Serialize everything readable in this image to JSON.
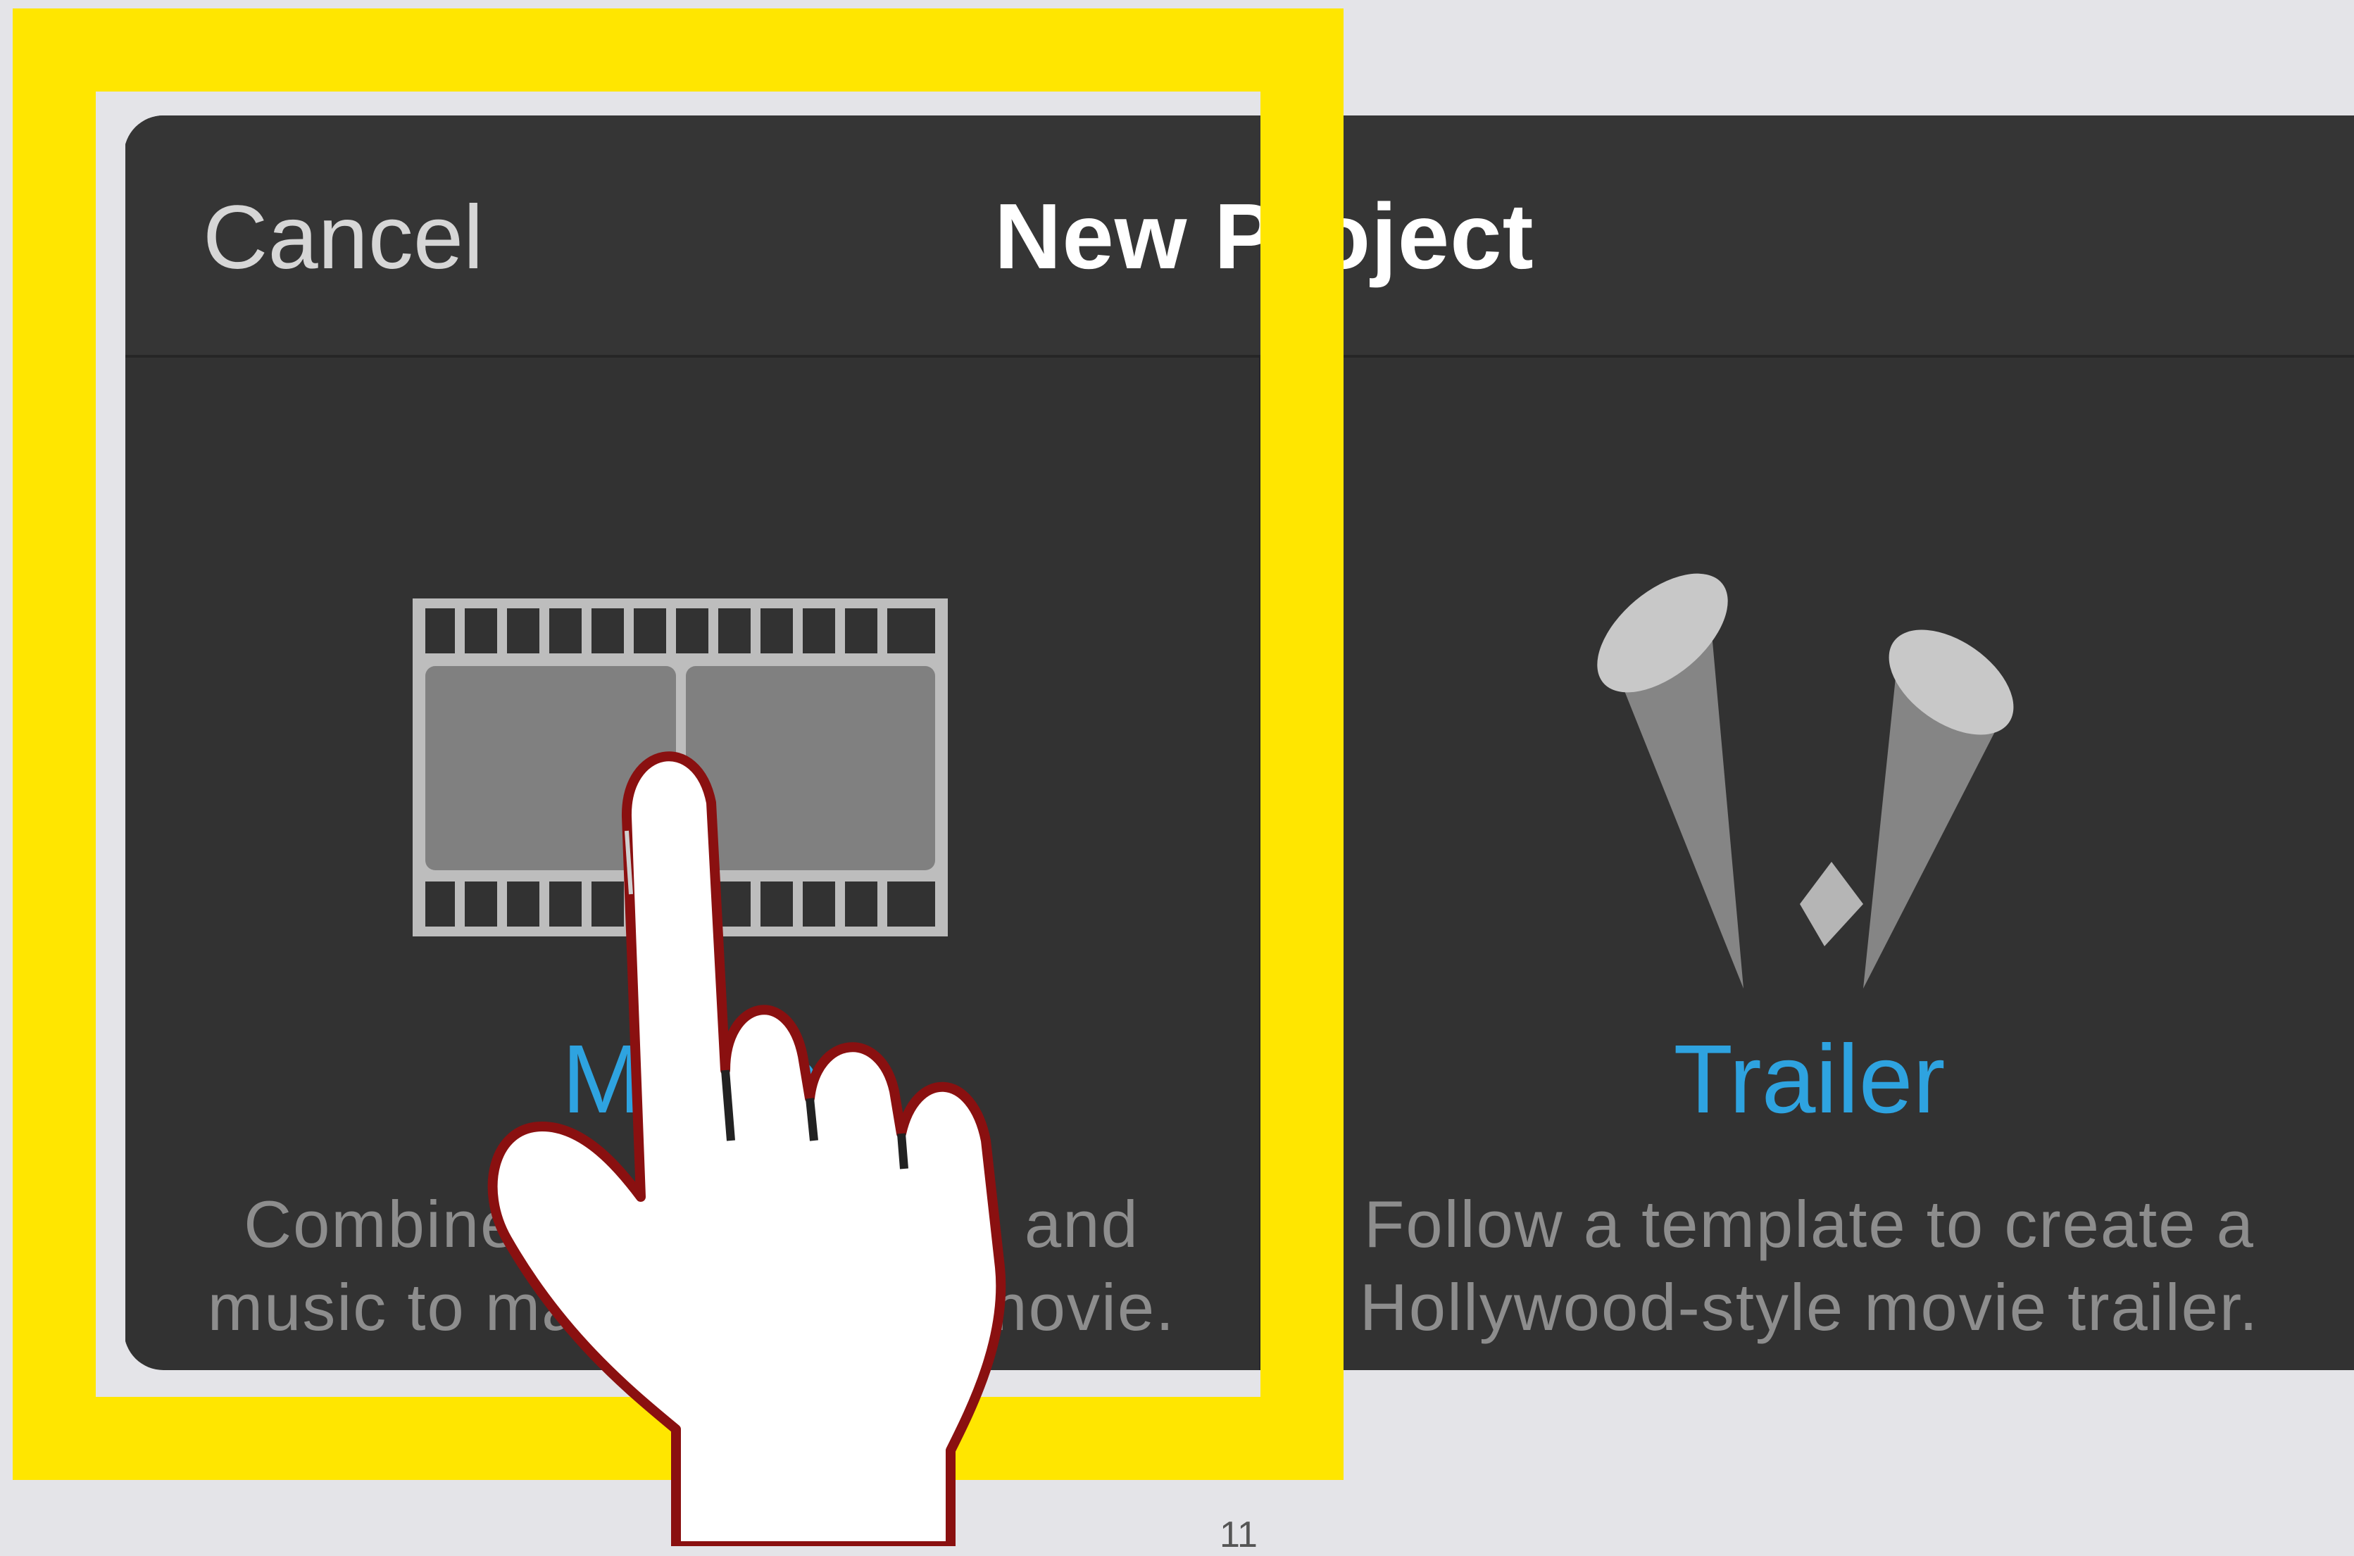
{
  "navbar": {
    "cancel_label": "Cancel",
    "title": "New Project"
  },
  "options": [
    {
      "label": "Movie",
      "description_line1": "Combine videos, photos, and",
      "description_line2": "music to make your own movie.",
      "icon": "film-strip-icon"
    },
    {
      "label": "Trailer",
      "description_line1": "Follow a template to create a",
      "description_line2": "Hollywood-style movie trailer.",
      "icon": "spotlights-icon"
    }
  ],
  "overlay": {
    "highlight_color": "#ffe600",
    "pointer_icon": "tap-hand-icon"
  },
  "colors": {
    "accent": "#2ea3e0",
    "panel": "#323232"
  },
  "page_number": "11"
}
